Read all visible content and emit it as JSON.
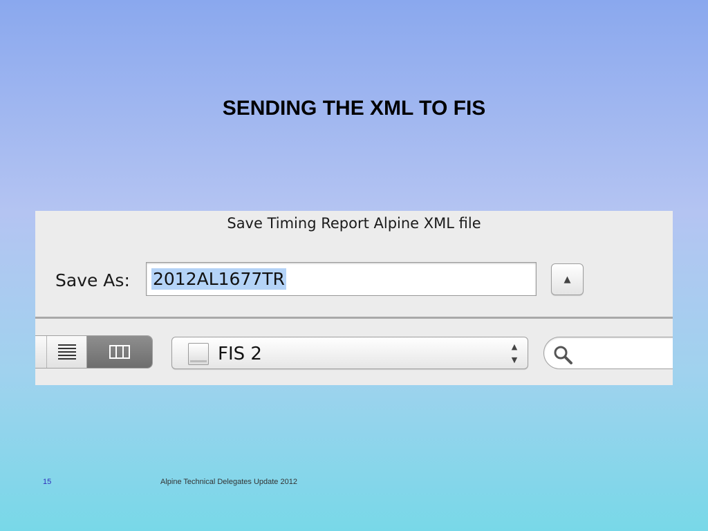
{
  "slide": {
    "title": "SENDING THE XML TO FIS",
    "page_number": "15",
    "footer": "Alpine Technical Delegates Update 2012"
  },
  "dialog": {
    "title": "Save Timing Report Alpine XML file",
    "save_as_label": "Save As:",
    "filename": "2012AL1677TR",
    "expand_icon": "triangle-up-icon",
    "view_modes": [
      "list-view-icon",
      "column-view-icon"
    ],
    "selected_view": "column",
    "location": "FIS 2",
    "search_placeholder": ""
  },
  "colors": {
    "selection_highlight": "#b4d3f7",
    "dialog_background": "#ececec",
    "background_top": "#8aa8ee",
    "background_bottom": "#78d8e8"
  }
}
